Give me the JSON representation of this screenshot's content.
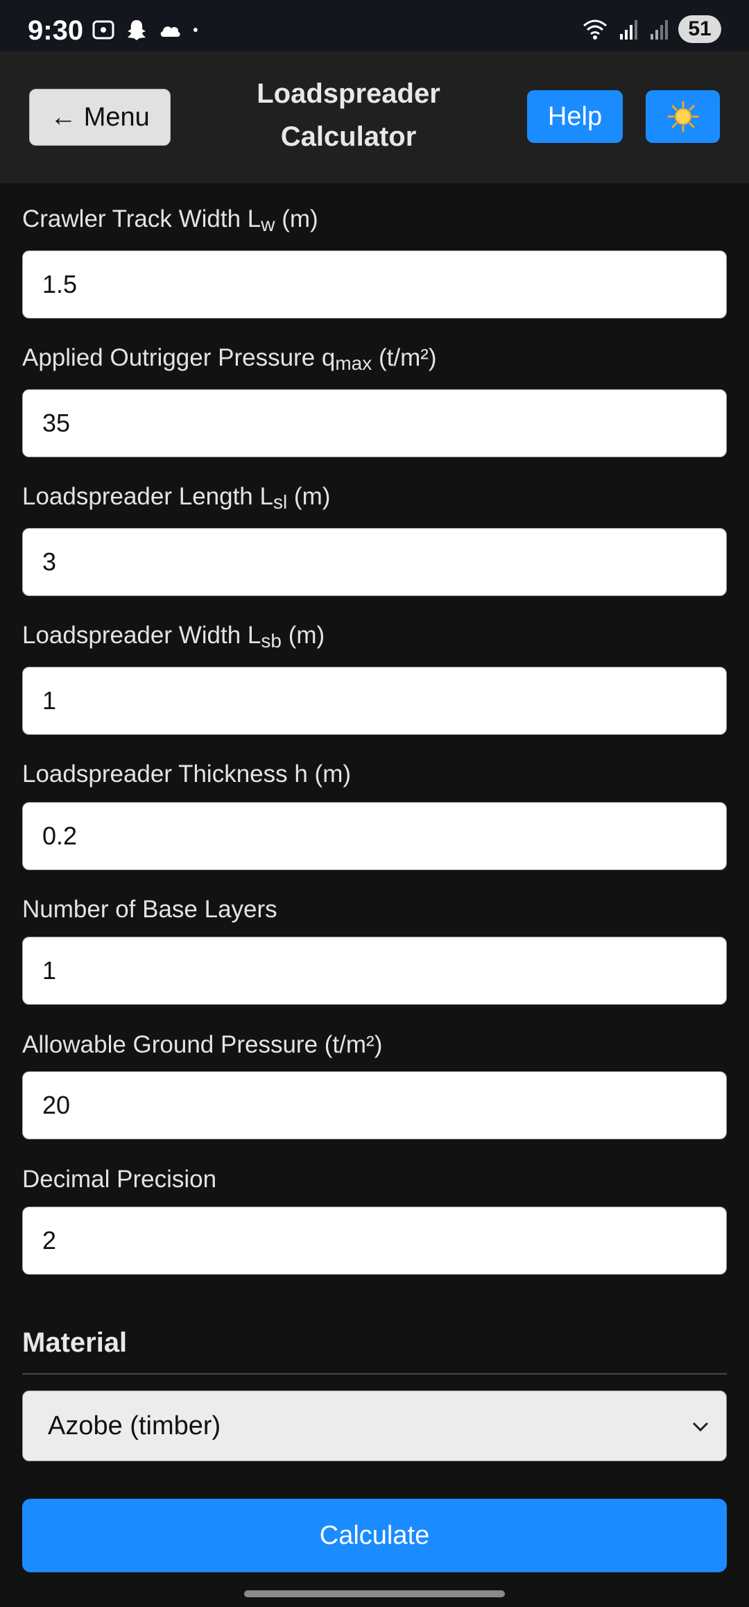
{
  "status_bar": {
    "time": "9:30",
    "battery": "51",
    "left_icons": [
      "screenshot-icon",
      "snapchat-icon",
      "cloud-icon",
      "dot-icon"
    ],
    "right_icons": [
      "wifi-icon",
      "signal-icon",
      "signal-icon"
    ]
  },
  "header": {
    "menu_label": "← Menu",
    "title_line1": "Loadspreader",
    "title_line2": "Calculator",
    "help_label": "Help",
    "theme_icon": "☀️"
  },
  "fields": {
    "track_width": {
      "label_main": "Crawler Track Width L",
      "label_sub": "w",
      "label_unit": " (m)",
      "value": "1.5"
    },
    "outrigger_pressure": {
      "label_main": "Applied Outrigger Pressure q",
      "label_sub": "max",
      "label_unit": " (t/m²)",
      "value": "35"
    },
    "ls_length": {
      "label_main": "Loadspreader Length L",
      "label_sub": "sl",
      "label_unit": " (m)",
      "value": "3"
    },
    "ls_width": {
      "label_main": "Loadspreader Width L",
      "label_sub": "sb",
      "label_unit": " (m)",
      "value": "1"
    },
    "ls_thickness": {
      "label": "Loadspreader Thickness h (m)",
      "value": "0.2"
    },
    "base_layers": {
      "label": "Number of Base Layers",
      "value": "1"
    },
    "ground_pressure": {
      "label": "Allowable Ground Pressure (t/m²)",
      "value": "20"
    },
    "precision": {
      "label": "Decimal Precision",
      "value": "2"
    }
  },
  "material": {
    "section_title": "Material",
    "selected": "Azobe (timber)"
  },
  "calculate_label": "Calculate",
  "colors": {
    "background": "#121212",
    "header": "#202020",
    "accent": "#1a8cff"
  }
}
